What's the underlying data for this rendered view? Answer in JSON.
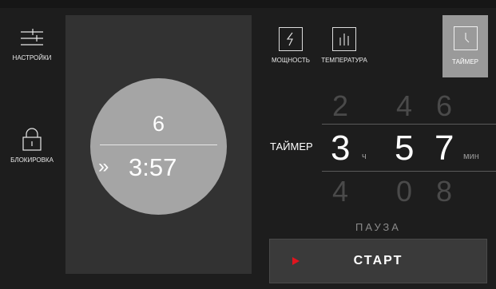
{
  "sidebar": {
    "settings_label": "НАСТРОЙКИ",
    "lock_label": "БЛОКИРОВКА"
  },
  "display": {
    "power_level": "6",
    "time": "3:57",
    "arrows": "»"
  },
  "modes": {
    "power_label": "МОЩНОСТЬ",
    "temperature_label": "ТЕМПЕРАТУРА",
    "timer_label": "ТАЙМЕР"
  },
  "picker": {
    "label": "ТАЙМЕР",
    "hours": {
      "prev": "2",
      "current": "3",
      "next": "4",
      "unit": "ч"
    },
    "minutes_tens": {
      "prev": "4",
      "current": "5",
      "next": "0"
    },
    "minutes_ones": {
      "prev": "6",
      "current": "7",
      "next": "8",
      "unit": "мин"
    }
  },
  "controls": {
    "pause_label": "ПАУЗА",
    "start_label": "СТАРТ"
  },
  "colors": {
    "accent": "#e0141e",
    "selected_mode_bg": "#9a9a9a",
    "circle": "#a5a5a5"
  }
}
